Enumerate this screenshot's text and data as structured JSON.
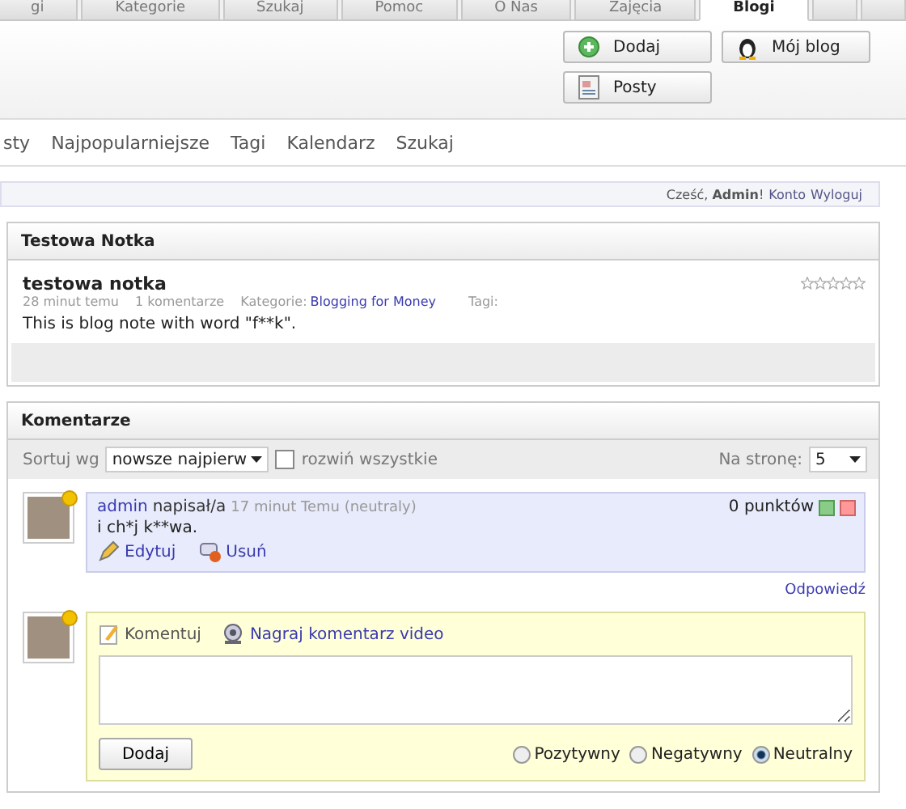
{
  "tabs": [
    {
      "label": "gi",
      "selected": false
    },
    {
      "label": "Kategorie",
      "selected": false
    },
    {
      "label": "Szukaj",
      "selected": false
    },
    {
      "label": "Pomoc",
      "selected": false
    },
    {
      "label": "O Nas",
      "selected": false
    },
    {
      "label": "Zajęcia",
      "selected": false
    },
    {
      "label": "Blogi",
      "selected": true
    }
  ],
  "header_buttons": [
    {
      "label": "Dodaj",
      "kind": "add"
    },
    {
      "label": "Mój blog",
      "kind": "penguin"
    },
    {
      "label": "Posty",
      "kind": "posts"
    }
  ],
  "nav": [
    "sty",
    "Najpopularniejsze",
    "Tagi",
    "Kalendarz",
    "Szukaj"
  ],
  "user_bar": {
    "greeting": "Cześć, **Admin**!",
    "links": [
      "Konto",
      "Wyloguj"
    ]
  },
  "post_panel": {
    "title": "Testowa Notka",
    "post_title": "testowa notka",
    "stars": 0,
    "time": "28 minut temu",
    "comments": "1 komentarze",
    "category_label": "Kategorie:",
    "category": "Blogging for Money",
    "tags_label": "Tagi:",
    "body": "This is blog note with word \"f**k\"."
  },
  "comments_panel": {
    "title": "Komentarze",
    "sort_label": "Sortuj wg",
    "sort_value": "nowsze najpierw",
    "expand_all": {
      "label": "rozwiń wszystkie",
      "checked": false
    },
    "per_page_label": "Na stronę:",
    "per_page_value": "5",
    "comments": [
      {
        "author": "admin",
        "verb": "napisał/a",
        "meta": "17 minut Temu (neutraly)",
        "points": "0 punktów",
        "text": "i ch*j k**wa.",
        "actions": [
          "Edytuj",
          "Usuń"
        ],
        "reply": "Odpowiedź"
      }
    ],
    "form": {
      "comment_tab": "Komentuj",
      "video_link": "Nagraj komentarz video",
      "submit": "Dodaj",
      "ratings": [
        {
          "label": "Pozytywny",
          "selected": false
        },
        {
          "label": "Negatywny",
          "selected": false
        },
        {
          "label": "Neutralny",
          "selected": true
        }
      ]
    }
  }
}
